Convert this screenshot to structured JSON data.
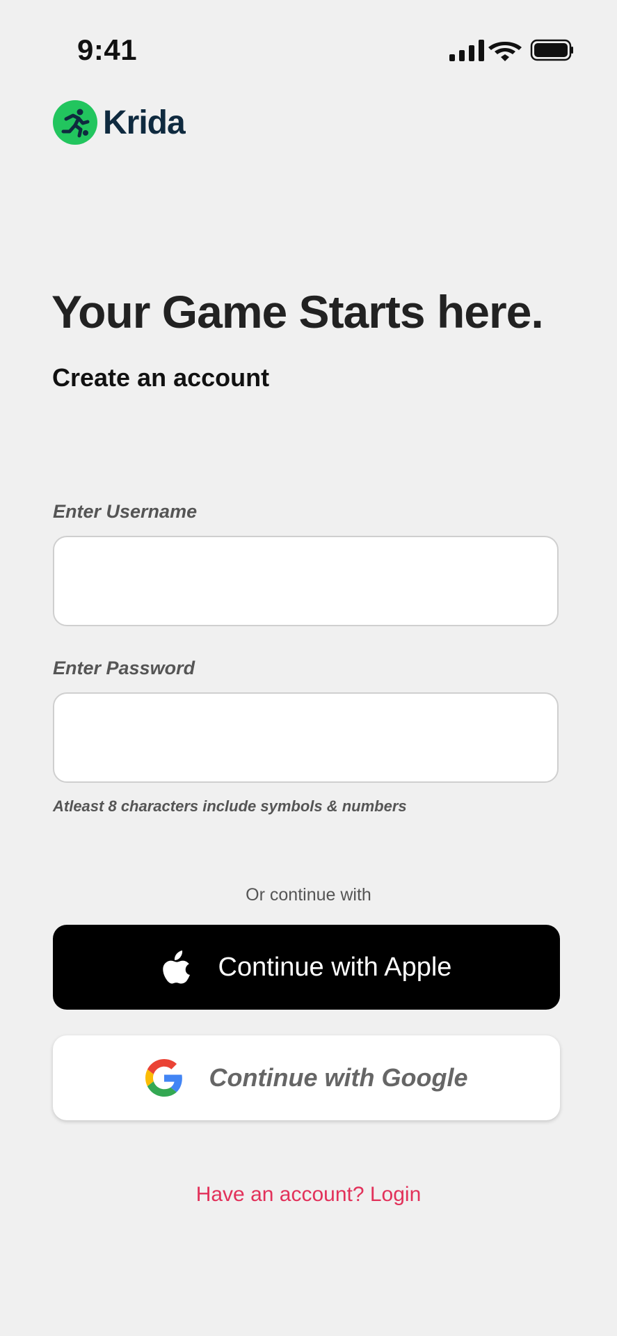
{
  "status_bar": {
    "time": "9:41"
  },
  "brand": {
    "name": "Krida",
    "accent_color": "#22c55e",
    "text_color": "#0f2a3f",
    "icon": "runner-icon"
  },
  "headline": "Your Game Starts here.",
  "subheadline": "Create an account",
  "form": {
    "username_label": "Enter Username",
    "username_value": "",
    "password_label": "Enter Password",
    "password_value": "",
    "password_hint": "Atleast 8 characters include symbols & numbers"
  },
  "divider_text": "Or continue with",
  "buttons": {
    "apple_label": "Continue with Apple",
    "google_label": "Continue with Google"
  },
  "login_link": "Have an account? Login",
  "colors": {
    "background": "#f0f0f0",
    "link": "#e2315a",
    "apple_button": "#000000"
  }
}
